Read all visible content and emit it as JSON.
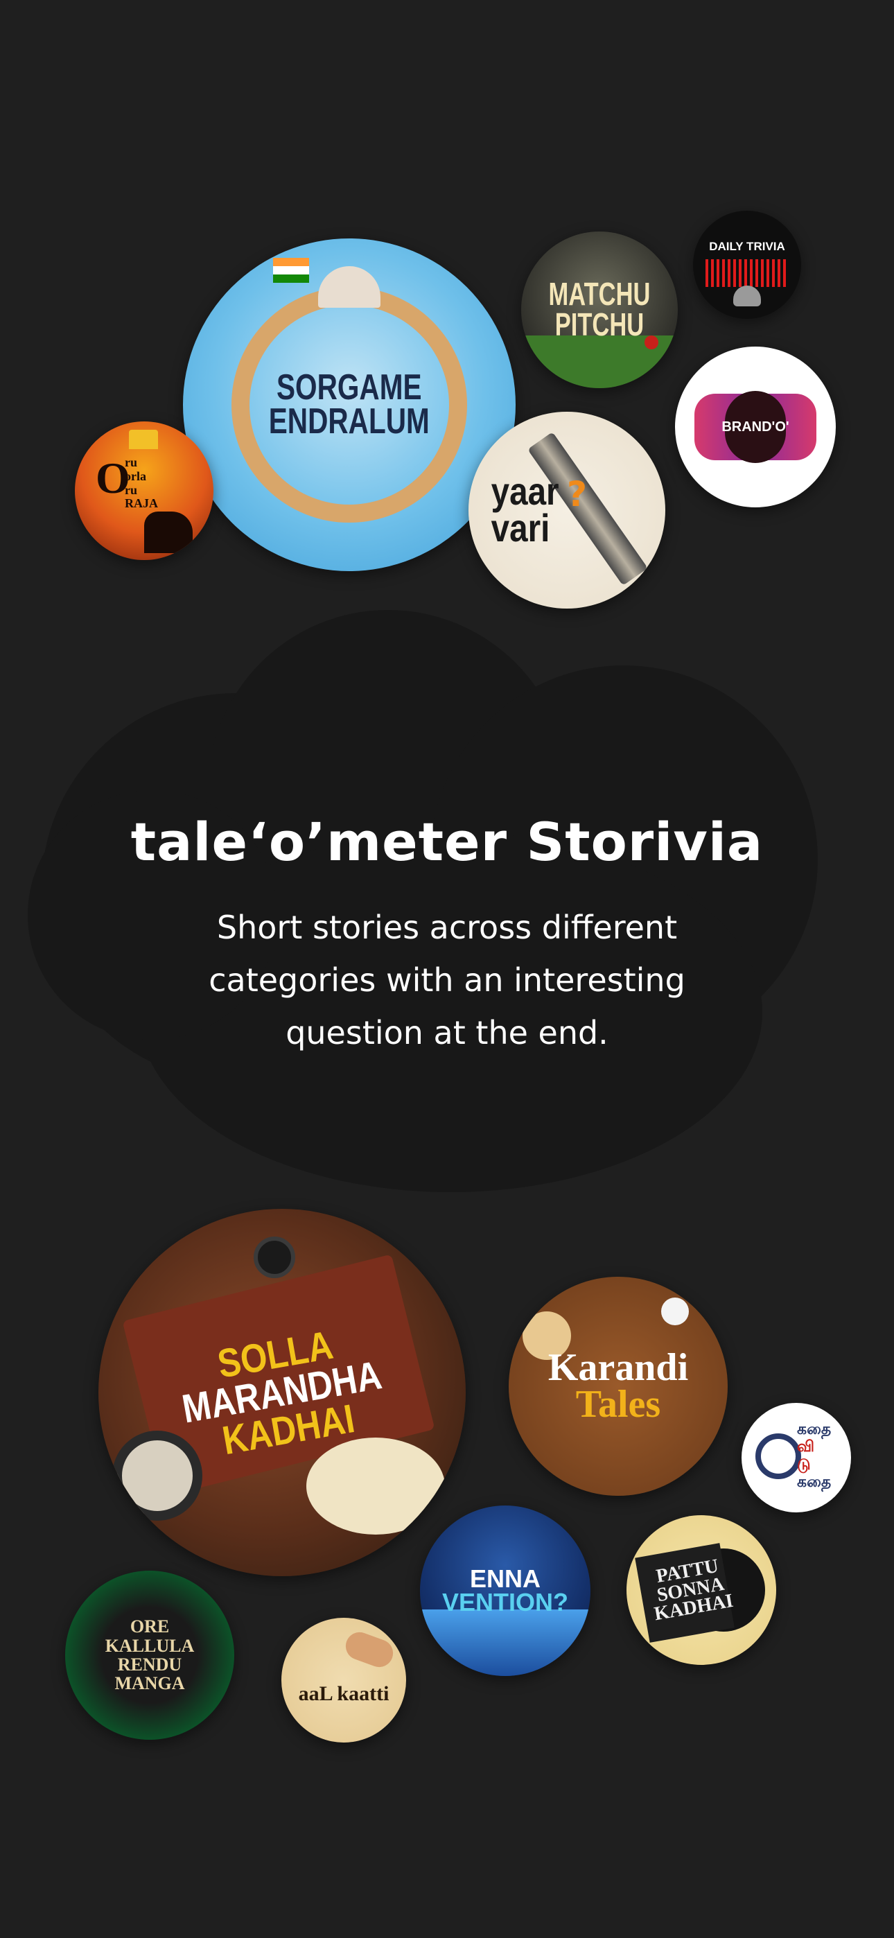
{
  "heading": "tale‘o’meter Storivia",
  "subtitle": "Short stories across different categories with an interesting question at the end.",
  "shows_top": {
    "sorgame": {
      "line1": "SORGAME",
      "line2": "ENDRALUM"
    },
    "matchu": {
      "line1": "MATCHU",
      "line2": "PITCHU"
    },
    "daily_trivia": "DAILY TRIVIA",
    "brando": "BRAND'O'",
    "oru_oorla": {
      "line1": "ru",
      "line2": "orla",
      "line3": "ru",
      "line4": "RAJA",
      "initial": "O"
    },
    "yaar_vari": {
      "line1": "yaar",
      "line2": "vari",
      "mark": "?"
    }
  },
  "shows_bottom": {
    "solla": {
      "line1": "SOLLA",
      "line2": "MARANDHA",
      "line3": "KADHAI"
    },
    "karandi": {
      "line1": "Karandi",
      "line2": "Tales"
    },
    "kathai_vitu": {
      "line1": "கதை",
      "line2": "வி",
      "line3": "டு",
      "line4": "கதை"
    },
    "enna_vention": {
      "line1": "ENNA",
      "line2": "VENTION?"
    },
    "pattu": {
      "line1": "PATTU",
      "line2": "SONNA",
      "line3": "KADHAI"
    },
    "ore_kallula": {
      "line1": "ORE",
      "line2": "KALLULA",
      "line3": "RENDU",
      "line4": "MANGA"
    },
    "aal_kaatti": "aaL kaatti"
  },
  "colors": {
    "background": "#1f1f1f",
    "text": "#ffffff"
  }
}
